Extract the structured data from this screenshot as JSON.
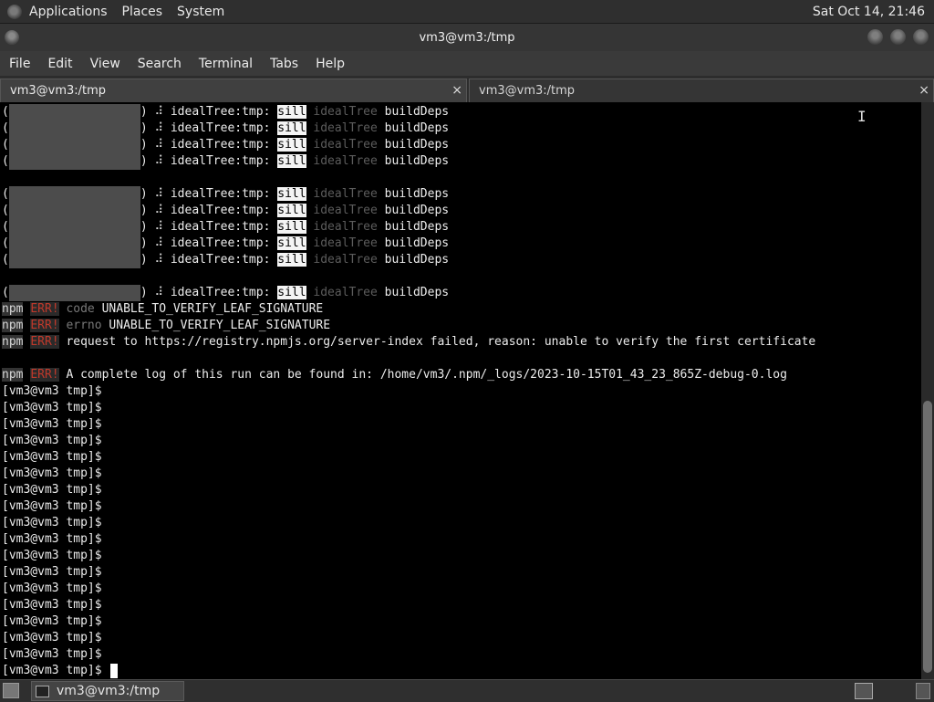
{
  "top_panel": {
    "menus": [
      "Applications",
      "Places",
      "System"
    ],
    "clock": "Sat Oct 14, 21:46"
  },
  "window": {
    "title": "vm3@vm3:/tmp"
  },
  "menubar": [
    "File",
    "Edit",
    "View",
    "Search",
    "Terminal",
    "Tabs",
    "Help"
  ],
  "tabs": [
    {
      "label": "vm3@vm3:/tmp",
      "close": "×",
      "active": true
    },
    {
      "label": "vm3@vm3:/tmp",
      "close": "×",
      "active": false
    }
  ],
  "terminal": {
    "idealtree_line": {
      "spinner": "⠼",
      "task": "idealTree:tmp:",
      "level": "sill",
      "section": "idealTree",
      "action": "buildDeps"
    },
    "npm_errors": [
      {
        "npm": "npm",
        "tag": "ERR!",
        "key": "code",
        "value": "UNABLE_TO_VERIFY_LEAF_SIGNATURE"
      },
      {
        "npm": "npm",
        "tag": "ERR!",
        "key": "errno",
        "value": "UNABLE_TO_VERIFY_LEAF_SIGNATURE"
      },
      {
        "npm": "npm",
        "tag": "ERR!",
        "key": "",
        "value": "request to https://registry.npmjs.org/server-index failed, reason: unable to verify the first certificate"
      }
    ],
    "log_line": {
      "npm": "npm",
      "tag": "ERR!",
      "value": "A complete log of this run can be found in: /home/vm3/.npm/_logs/2023-10-15T01_43_23_865Z-debug-0.log"
    },
    "prompt": "[vm3@vm3 tmp]$"
  },
  "taskbar": {
    "task_label": "vm3@vm3:/tmp"
  }
}
